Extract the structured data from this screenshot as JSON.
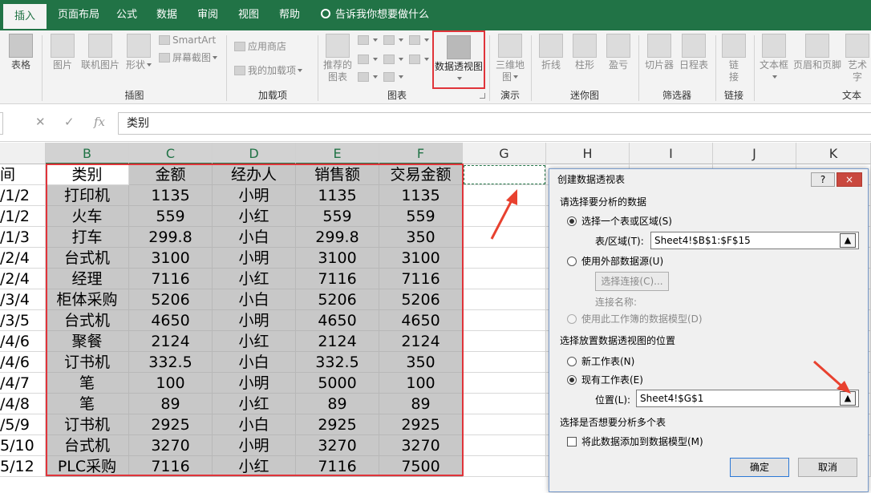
{
  "ribbon_tabs": [
    "插入",
    "页面布局",
    "公式",
    "数据",
    "审阅",
    "视图",
    "帮助"
  ],
  "tell_me": "告诉我你想要做什么",
  "ribbon": {
    "table": "表格",
    "picture": "图片",
    "online_picture": "联机图片",
    "shapes": "形状",
    "smartart": "SmartArt",
    "screenshot": "屏幕截图",
    "illustrations_group": "插图",
    "store": "应用商店",
    "my_addins": "我的加载项",
    "addins_group": "加载项",
    "recommended_charts_1": "推荐的",
    "recommended_charts_2": "图表",
    "pivot_chart_1": "数据透视图",
    "charts_group": "图表",
    "map3d_1": "三维地",
    "map3d_2": "图",
    "tours_group": "演示",
    "spark_line": "折线",
    "spark_column": "柱形",
    "spark_winloss": "盈亏",
    "sparklines_group": "迷你图",
    "slicer": "切片器",
    "timeline": "日程表",
    "filters_group": "筛选器",
    "link_1": "链",
    "link_2": "接",
    "links_group": "链接",
    "textbox": "文本框",
    "header_footer": "页眉和页脚",
    "wordart": "艺术字",
    "text_group": "文本"
  },
  "formula_bar": {
    "fx": "fx",
    "value": "类别"
  },
  "columns": [
    "B",
    "C",
    "D",
    "E",
    "F",
    "G",
    "H",
    "I",
    "J",
    "K"
  ],
  "col_a_cells": [
    "间",
    "/1/2",
    "/1/2",
    "/1/3",
    "/2/4",
    "/2/4",
    "/3/4",
    "/3/5",
    "/4/6",
    "/4/6",
    "/4/7",
    "/4/8",
    "/5/9",
    "5/10",
    "5/12"
  ],
  "table": {
    "headers": [
      "类别",
      "金额",
      "经办人",
      "销售额",
      "交易金额"
    ],
    "rows": [
      [
        "打印机",
        "1135",
        "小明",
        "1135",
        "1135"
      ],
      [
        "火车",
        "559",
        "小红",
        "559",
        "559"
      ],
      [
        "打车",
        "299.8",
        "小白",
        "299.8",
        "350"
      ],
      [
        "台式机",
        "3100",
        "小明",
        "3100",
        "3100"
      ],
      [
        "经理",
        "7116",
        "小红",
        "7116",
        "7116"
      ],
      [
        "柜体采购",
        "5206",
        "小白",
        "5206",
        "5206"
      ],
      [
        "台式机",
        "4650",
        "小明",
        "4650",
        "4650"
      ],
      [
        "聚餐",
        "2124",
        "小红",
        "2124",
        "2124"
      ],
      [
        "订书机",
        "332.5",
        "小白",
        "332.5",
        "350"
      ],
      [
        "笔",
        "100",
        "小明",
        "5000",
        "100"
      ],
      [
        "笔",
        "89",
        "小红",
        "89",
        "89"
      ],
      [
        "订书机",
        "2925",
        "小白",
        "2925",
        "2925"
      ],
      [
        "台式机",
        "3270",
        "小明",
        "3270",
        "3270"
      ],
      [
        "PLC采购",
        "7116",
        "小红",
        "7116",
        "7500"
      ]
    ]
  },
  "dialog": {
    "title": "创建数据透视表",
    "help": "?",
    "close": "×",
    "section_choose": "请选择要分析的数据",
    "opt_range": "选择一个表或区域(S)",
    "range_label": "表/区域(T):",
    "range_value": "Sheet4!$B$1:$F$15",
    "opt_external": "使用外部数据源(U)",
    "choose_connection": "选择连接(C)...",
    "connection_name": "连接名称:",
    "opt_model": "使用此工作簿的数据模型(D)",
    "section_place": "选择放置数据透视图的位置",
    "opt_new_sheet": "新工作表(N)",
    "opt_existing_sheet": "现有工作表(E)",
    "location_label": "位置(L):",
    "location_value": "Sheet4!$G$1",
    "section_multi": "选择是否想要分析多个表",
    "add_to_model": "将此数据添加到数据模型(M)",
    "ok": "确定",
    "cancel": "取消"
  },
  "colors": {
    "excel_green": "#217346",
    "highlight_red": "#e0343a",
    "selection_gray": "#c8c8c8"
  }
}
